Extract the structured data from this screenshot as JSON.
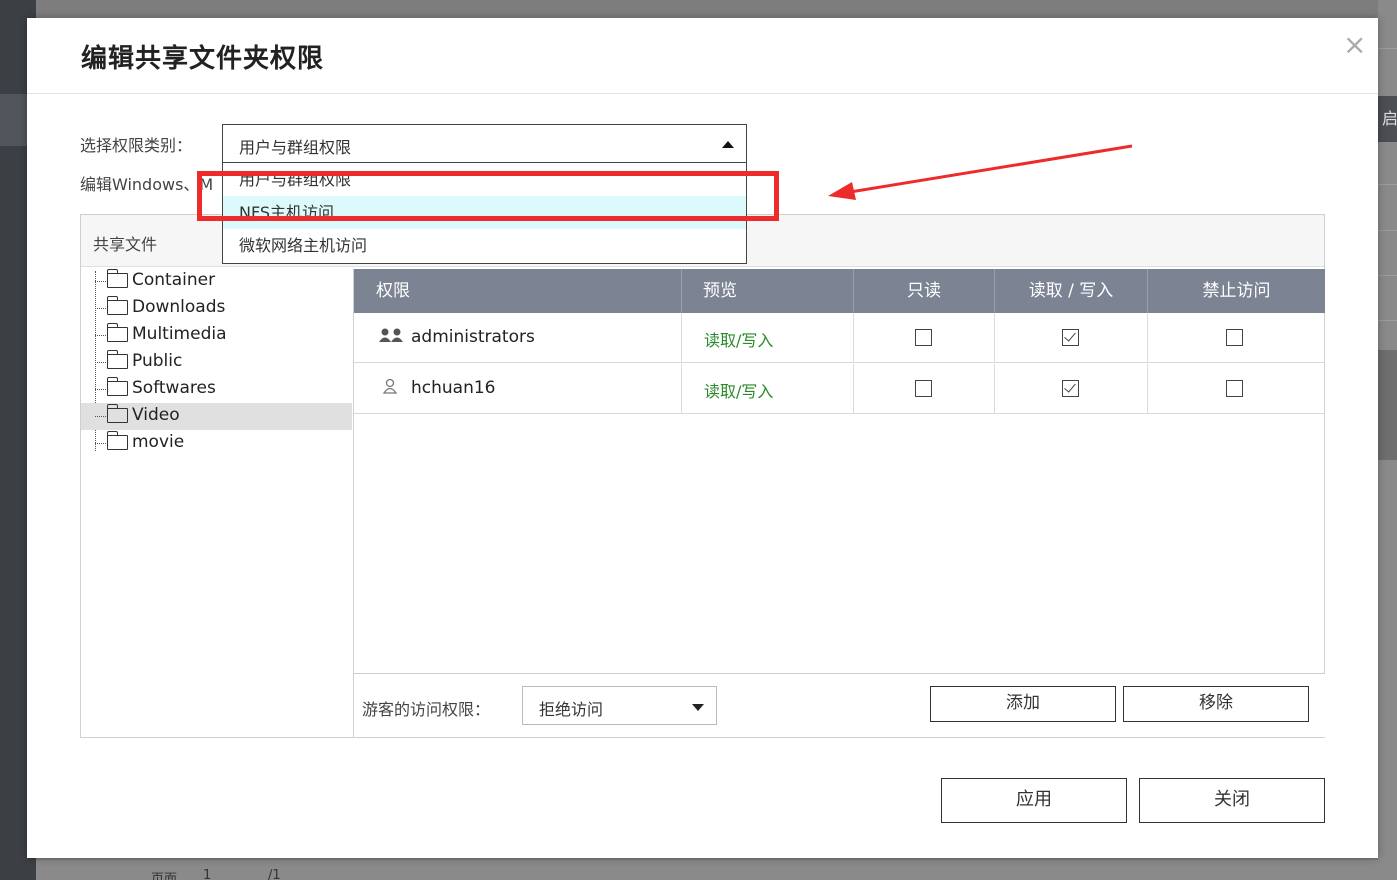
{
  "background": {
    "right_tab_char": "启",
    "pager_label": "页面",
    "pager_current": "1",
    "pager_total": "/1"
  },
  "dialog": {
    "title": "编辑共享文件夹权限",
    "close_icon": "×",
    "category_label": "选择权限类别：",
    "category_selected": "用户与群组权限",
    "edit_label": "编辑Windows、M",
    "dropdown_options": [
      "用户与群组权限",
      "NFS主机访问",
      "微软网络主机访问"
    ],
    "dropdown_highlighted_index": 1
  },
  "panel": {
    "header": "共享文件",
    "folders": [
      "Container",
      "Downloads",
      "Multimedia",
      "Public",
      "Softwares",
      "Video",
      "movie"
    ],
    "selected_folder": "Video",
    "columns": [
      "权限",
      "预览",
      "只读",
      "读取 / 写入",
      "禁止访问"
    ],
    "rows": [
      {
        "name": "administrators",
        "icon": "group-icon",
        "preview": "读取/写入",
        "read_only": false,
        "read_write": true,
        "deny": false
      },
      {
        "name": "hchuan16",
        "icon": "user-icon",
        "preview": "读取/写入",
        "read_only": false,
        "read_write": true,
        "deny": false
      }
    ],
    "guest_label": "游客的访问权限：",
    "guest_selected": "拒绝访问",
    "add_label": "添加",
    "remove_label": "移除"
  },
  "footer": {
    "apply_label": "应用",
    "close_label": "关闭"
  },
  "colors": {
    "grid_header": "#7c8494",
    "highlight_option": "#dcfafb",
    "annotation_red": "#ee2b2b",
    "preview_green": "#2a8a2a"
  }
}
